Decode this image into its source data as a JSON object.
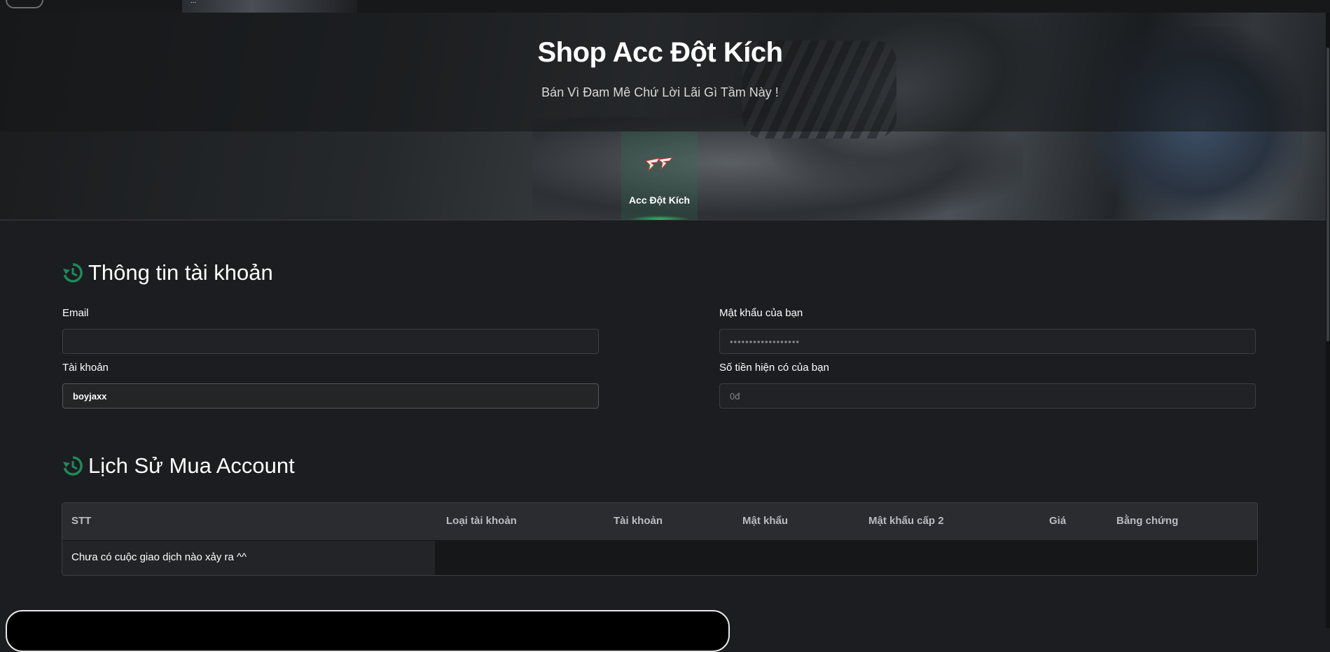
{
  "topbar": {
    "thumb_text": "..."
  },
  "hero": {
    "title": "Shop Acc Đột Kích",
    "subtitle": "Bán Vì Đam Mê Chứ Lời Lãi Gì Tầm Này !",
    "tab_label": "Acc Đột Kích"
  },
  "account": {
    "title": "Thông tin tài khoản",
    "email_label": "Email",
    "email_value": "",
    "password_label": "Mật khẩu của bạn",
    "password_value": "••••••••••••••••••",
    "username_label": "Tài khoản",
    "username_value": "boyjaxx",
    "balance_label": "Số tiền hiện có của bạn",
    "balance_value": "0đ"
  },
  "history": {
    "title": "Lịch Sử Mua Account",
    "columns": [
      "STT",
      "Loại tài khoản",
      "Tài khoản",
      "Mật khẩu",
      "Mật khẩu cấp 2",
      "Giá",
      "Bằng chứng"
    ],
    "empty_message": "Chưa có cuộc giao dịch nào xảy ra ^^"
  },
  "colors": {
    "accent": "#1e8a5a",
    "background": "#1b1d20"
  },
  "icons": {
    "section": "history-icon",
    "tab": "crossfire-logo-icon"
  }
}
